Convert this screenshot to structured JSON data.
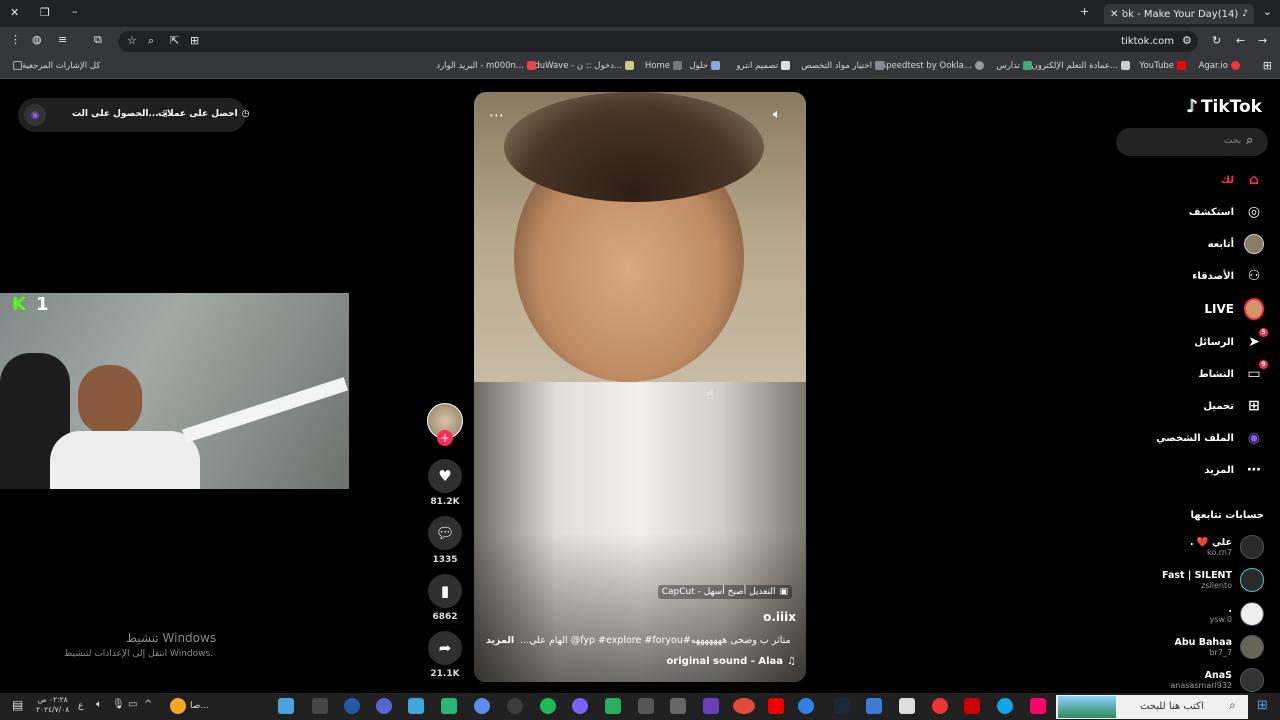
{
  "browser": {
    "tab_title": "(14)TikTok - Make Your Day",
    "url": "tiktok.com",
    "bookmarks": [
      "Agar.io",
      "YouTube",
      "عمادة التعلم الإلكترون...",
      "تدارس",
      "Speedtest by Ookla...",
      "اختيار مواد التخصص",
      "تصميم انترو",
      "حلول",
      "Home",
      "EduWave - دخول :: ن...",
      "البريد الوارد - m000n...",
      "كل الإشارات المرجعية"
    ]
  },
  "tiktok": {
    "logo": "TikTok",
    "search_placeholder": "بحث",
    "nav": [
      {
        "label": "لك",
        "icon": "home-icon"
      },
      {
        "label": "استكشف",
        "icon": "compass-icon"
      },
      {
        "label": "أتابعه",
        "icon": "avatar-icon"
      },
      {
        "label": "الأصدقاء",
        "icon": "friends-icon"
      },
      {
        "label": "LIVE",
        "icon": "live-icon"
      },
      {
        "label": "الرسائل",
        "icon": "send-icon",
        "badge": "5"
      },
      {
        "label": "النشاط",
        "icon": "inbox-icon",
        "badge": "9"
      },
      {
        "label": "تحميل",
        "icon": "upload-icon"
      },
      {
        "label": "الملف الشخصي",
        "icon": "profile-icon"
      },
      {
        "label": "المزيد",
        "icon": "more-icon"
      }
    ],
    "following_title": "حسابات تتابعها",
    "following": [
      {
        "name": "علي ❤️ .",
        "handle": "ko.rn7"
      },
      {
        "name": "Fast | SILENT",
        "handle": "zsilento"
      },
      {
        "name": ".",
        "handle": "ysw.0"
      },
      {
        "name": "Abu Bahaa",
        "handle": "br7_7"
      },
      {
        "name": "AnaS",
        "handle": "anasasmari932"
      }
    ],
    "top_pill": {
      "coins": "احصل على عملات",
      "app": "الحصول على الت..."
    },
    "video": {
      "capcut": "CapCut - التعديل أصبح أسهل",
      "author": "o.iiix",
      "caption": "متأثر ب وضحى هههههههه#fyp #explore #foryou@ الهام علي...",
      "more": "المزيد",
      "sound": "original sound - Alaa",
      "likes": "81.2K",
      "comments": "1335",
      "saves": "6862",
      "shares": "21.1K"
    },
    "streamer_badge": "1"
  },
  "windows": {
    "activate_title": "تنشيط Windows",
    "activate_sub": "انتقل إلى الإعدادات لتنشيط Windows.",
    "search": "اكتب هنا للبحث",
    "time": "٠٢:٢٨ ص",
    "date": "٢٠٢٤/٧/٠٨",
    "lang": "ع",
    "cortana": "صا..."
  }
}
